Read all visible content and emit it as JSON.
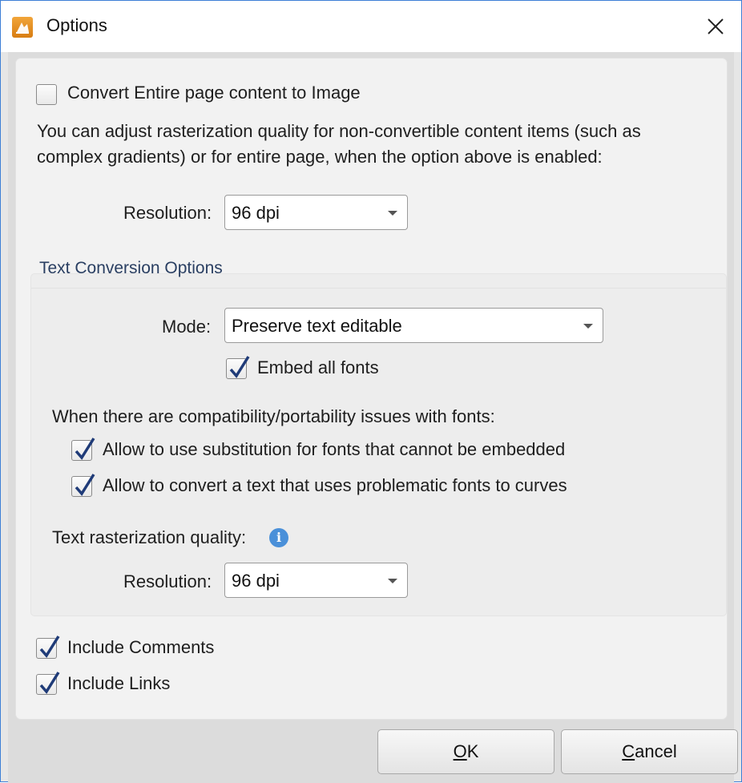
{
  "window": {
    "title": "Options",
    "close_icon": "close-icon",
    "app_icon": "app-logo-icon"
  },
  "convert_entire_page": {
    "label": "Convert Entire page content to Image",
    "checked": false
  },
  "description": {
    "line1": "You can adjust rasterization quality for non-convertible content items (such as",
    "line2": "complex gradients) or for entire page, when the option above is enabled:"
  },
  "page_resolution": {
    "label": "Resolution:",
    "value": "96 dpi"
  },
  "text_conversion": {
    "title": "Text Conversion Options",
    "mode": {
      "label": "Mode:",
      "value": "Preserve text editable"
    },
    "embed_all_fonts": {
      "label": "Embed all fonts",
      "checked": true
    },
    "compat_heading": "When there are compatibility/portability issues with fonts:",
    "allow_substitution": {
      "label": "Allow to use substitution for fonts that cannot be embedded",
      "checked": true
    },
    "allow_curves": {
      "label": "Allow to convert a text that uses problematic fonts to curves",
      "checked": true
    },
    "raster_quality_label": "Text rasterization quality:",
    "info_icon": "i",
    "resolution": {
      "label": "Resolution:",
      "value": "96 dpi"
    }
  },
  "include_comments": {
    "label": "Include Comments",
    "checked": true
  },
  "include_links": {
    "label": "Include Links",
    "checked": true
  },
  "buttons": {
    "ok_hotkey": "O",
    "ok_rest": "K",
    "cancel_hotkey": "C",
    "cancel_rest": "ancel"
  }
}
